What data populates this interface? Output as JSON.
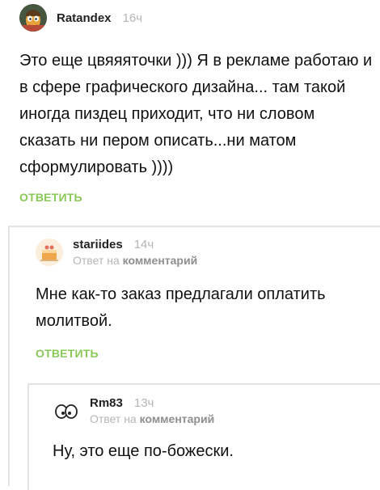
{
  "comments": [
    {
      "author": "Ratandex",
      "time": "16ч",
      "text": "Это еще цвяяяточки ))) Я в рекламе работаю и в сфере графического дизайна... там такой иногда пиздец приходит, что ни словом сказать ни пером описать...ни матом сформулировать ))))",
      "reply_label": "ОТВЕТИТЬ",
      "avatar_icon": "cartoon-face-avatar-icon"
    },
    {
      "author": "stariides",
      "time": "14ч",
      "reply_prefix": "Ответ на",
      "reply_target": "комментарий",
      "text": "Мне как-то заказ предлагали оплатить молитвой.",
      "reply_label": "ОТВЕТИТЬ",
      "avatar_icon": "cake-avatar-icon"
    },
    {
      "author": "Rm83",
      "time": "13ч",
      "reply_prefix": "Ответ на",
      "reply_target": "комментарий",
      "text": "Ну, это еще по-божески.",
      "avatar_icon": "eyes-avatar-icon"
    }
  ],
  "colors": {
    "accent_green": "#8ac858",
    "muted_gray": "#b5b5b5",
    "thread_line": "#e3e3e3"
  }
}
